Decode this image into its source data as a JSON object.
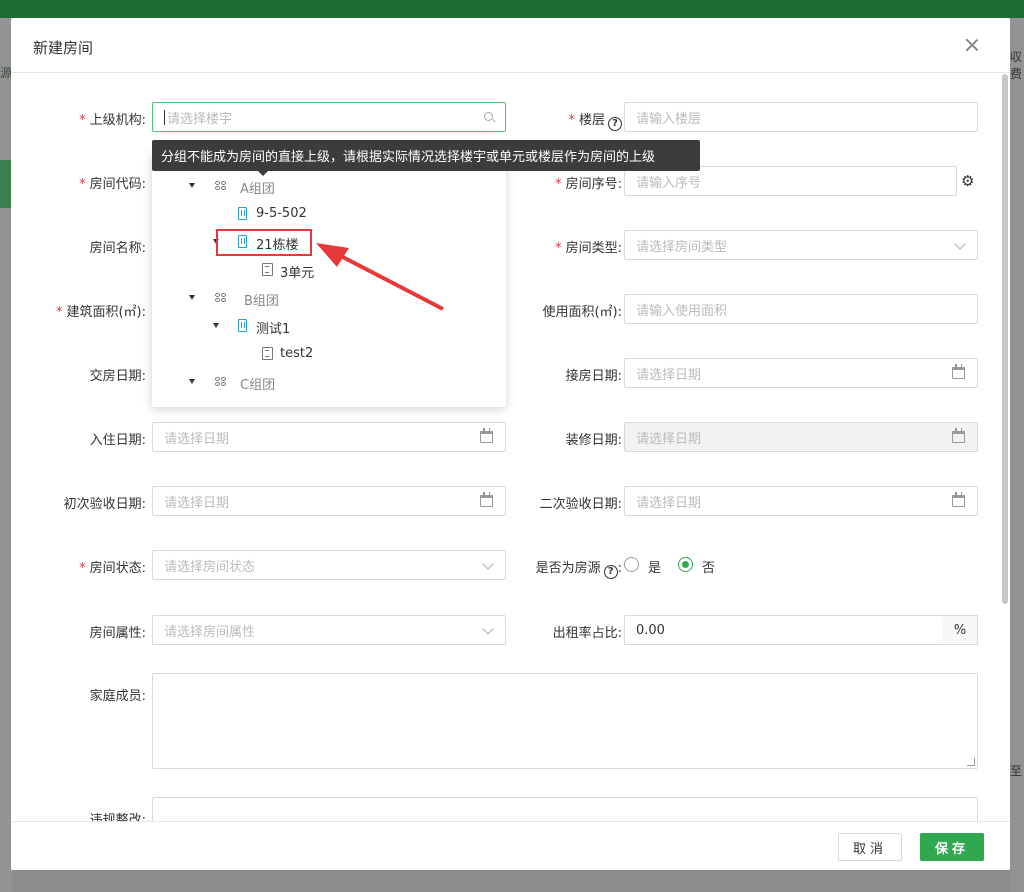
{
  "background": {
    "left_text": "源",
    "right_text_top": "収费",
    "right_text_bottom": "至"
  },
  "modal": {
    "title": "新建房间",
    "cancel_label": "取消",
    "save_label": "保存"
  },
  "form": {
    "parent_org": {
      "label": "上级机构:",
      "placeholder": "请选择楼宇"
    },
    "floor": {
      "label": "楼层",
      "placeholder": "请输入楼层"
    },
    "room_code": {
      "label": "房间代码:"
    },
    "room_seq": {
      "label": "房间序号:",
      "placeholder": "请输入序号"
    },
    "room_name": {
      "label": "房间名称:"
    },
    "room_type": {
      "label": "房间类型:",
      "placeholder": "请选择房间类型"
    },
    "build_area": {
      "label": "建筑面积(㎡):"
    },
    "use_area": {
      "label": "使用面积(㎡):",
      "placeholder": "请输入使用面积"
    },
    "handover_date": {
      "label": "交房日期:"
    },
    "receive_date": {
      "label": "接房日期:",
      "placeholder": "请选择日期"
    },
    "checkin_date": {
      "label": "入住日期:",
      "placeholder": "请选择日期"
    },
    "decorate_date": {
      "label": "装修日期:",
      "placeholder": "请选择日期"
    },
    "first_inspect_date": {
      "label": "初次验收日期:",
      "placeholder": "请选择日期"
    },
    "second_inspect_date": {
      "label": "二次验收日期:",
      "placeholder": "请选择日期"
    },
    "room_status": {
      "label": "房间状态:",
      "placeholder": "请选择房间状态"
    },
    "is_source": {
      "label": "是否为房源",
      "yes": "是",
      "no": "否",
      "selected": "否"
    },
    "room_attr": {
      "label": "房间属性:",
      "placeholder": "请选择房间属性"
    },
    "rent_ratio": {
      "label": "出租率占比:",
      "value": "0.00",
      "unit": "%"
    },
    "family": {
      "label": "家庭成员:"
    },
    "violation": {
      "label": "违规整改:"
    },
    "help_glyph": "?"
  },
  "tooltip": {
    "text": "分组不能成为房间的直接上级，请根据实际情况选择楼宇或单元或楼层作为房间的上级"
  },
  "tree": {
    "group_a": "A组团",
    "room_9_5_502": "9-5-502",
    "building_21": "21栋楼",
    "unit_3": "3单元",
    "group_b": "B组团",
    "test_1": "测试1",
    "test_2": "test2",
    "group_c": "C组团"
  },
  "colors": {
    "primary": "#2fa84f",
    "required": "#e5323e",
    "annotation": "#e53a3a",
    "building_icon": "#2a9fd6"
  }
}
